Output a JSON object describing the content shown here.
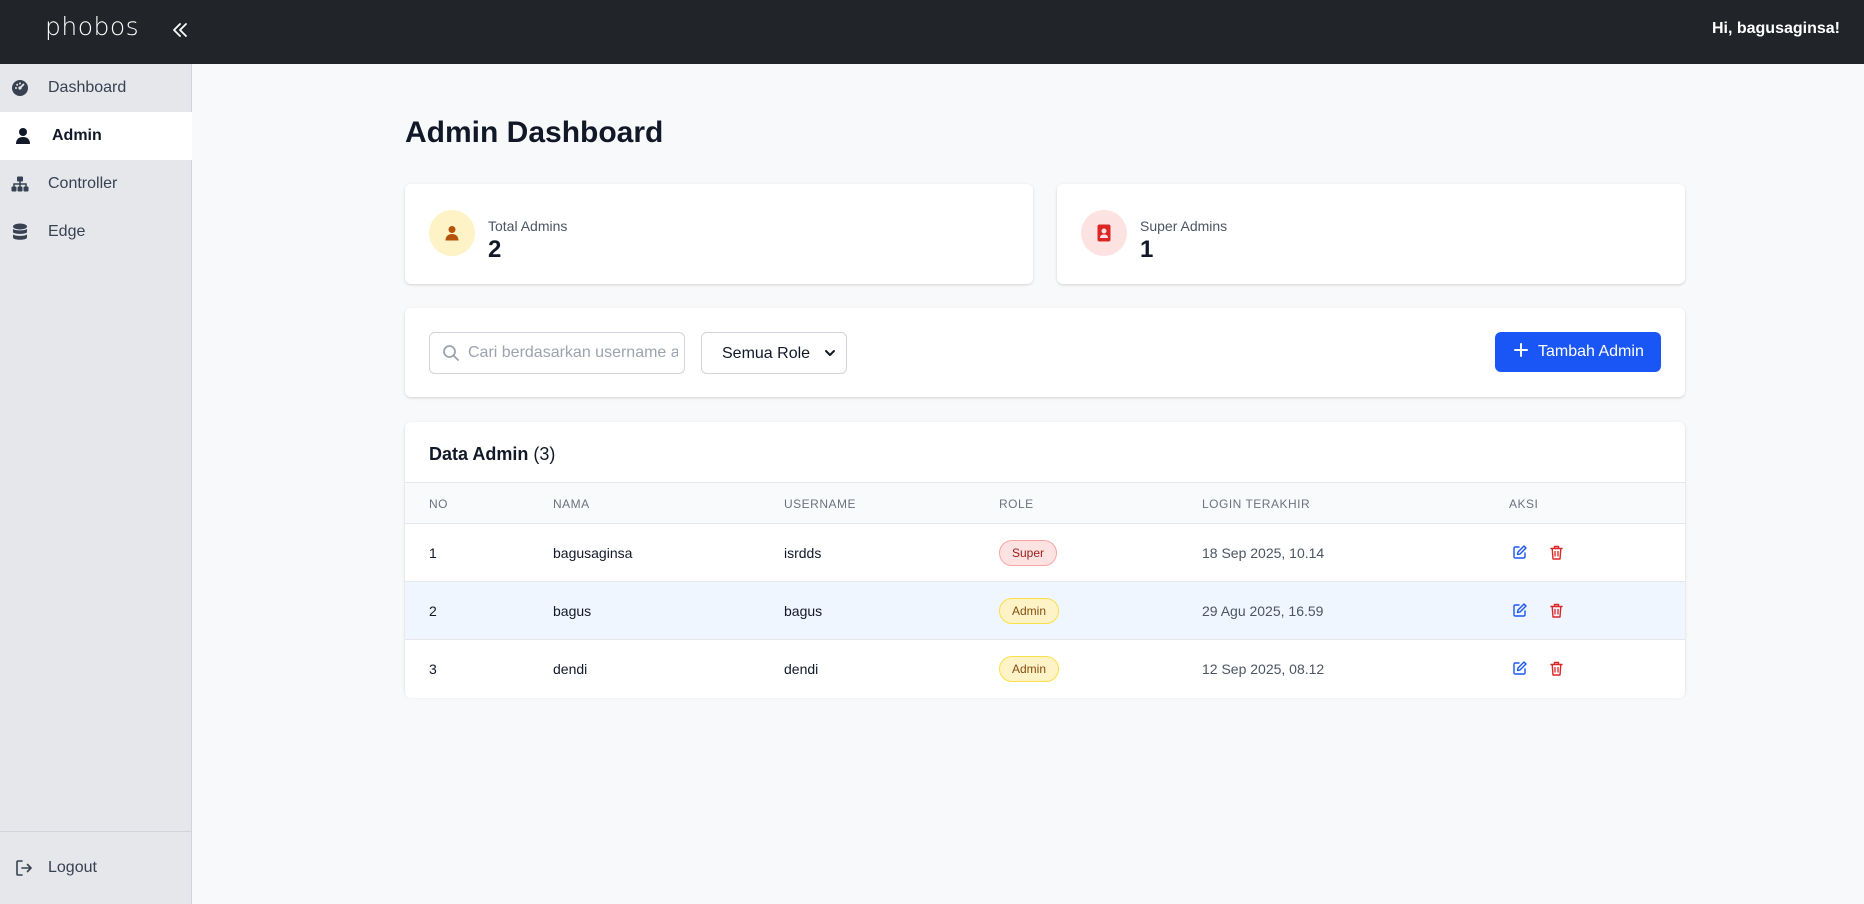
{
  "app": {
    "logo": "phobos",
    "greeting": "Hi, bagusaginsa!"
  },
  "sidebar": {
    "items": [
      {
        "label": "Dashboard",
        "icon": "dashboard-icon"
      },
      {
        "label": "Admin",
        "icon": "user-icon",
        "active": true
      },
      {
        "label": "Controller",
        "icon": "network-icon"
      },
      {
        "label": "Edge",
        "icon": "database-icon"
      }
    ],
    "logout": {
      "label": "Logout",
      "icon": "logout-icon"
    }
  },
  "main": {
    "title": "Admin Dashboard",
    "stats": [
      {
        "label": "Total Admins",
        "value": "2",
        "icon": "user-icon"
      },
      {
        "label": "Super Admins",
        "value": "1",
        "icon": "id-badge-icon"
      }
    ],
    "search": {
      "placeholder": "Cari berdasarkan username atau nama",
      "value": ""
    },
    "role_filter": {
      "selected": "Semua Role"
    },
    "add_button": {
      "label": "Tambah Admin"
    },
    "table": {
      "title": "Data Admin",
      "count": "(3)",
      "columns": [
        "NO",
        "NAMA",
        "USERNAME",
        "ROLE",
        "LOGIN TERAKHIR",
        "AKSI"
      ],
      "rows": [
        {
          "no": "1",
          "nama": "bagusaginsa",
          "username": "isrdds",
          "role": "Super",
          "login": "18 Sep 2025, 10.14"
        },
        {
          "no": "2",
          "nama": "bagus",
          "username": "bagus",
          "role": "Admin",
          "login": "29 Agu 2025, 16.59"
        },
        {
          "no": "3",
          "nama": "dendi",
          "username": "dendi",
          "role": "Admin",
          "login": "12 Sep 2025, 08.12"
        }
      ]
    }
  },
  "colors": {
    "topbar": "#212529",
    "sidebar": "#e5e7eb",
    "primary": "#1a56f5",
    "danger": "#dc2626",
    "super_badge": "#fde2e2",
    "admin_badge": "#fef3c7"
  }
}
